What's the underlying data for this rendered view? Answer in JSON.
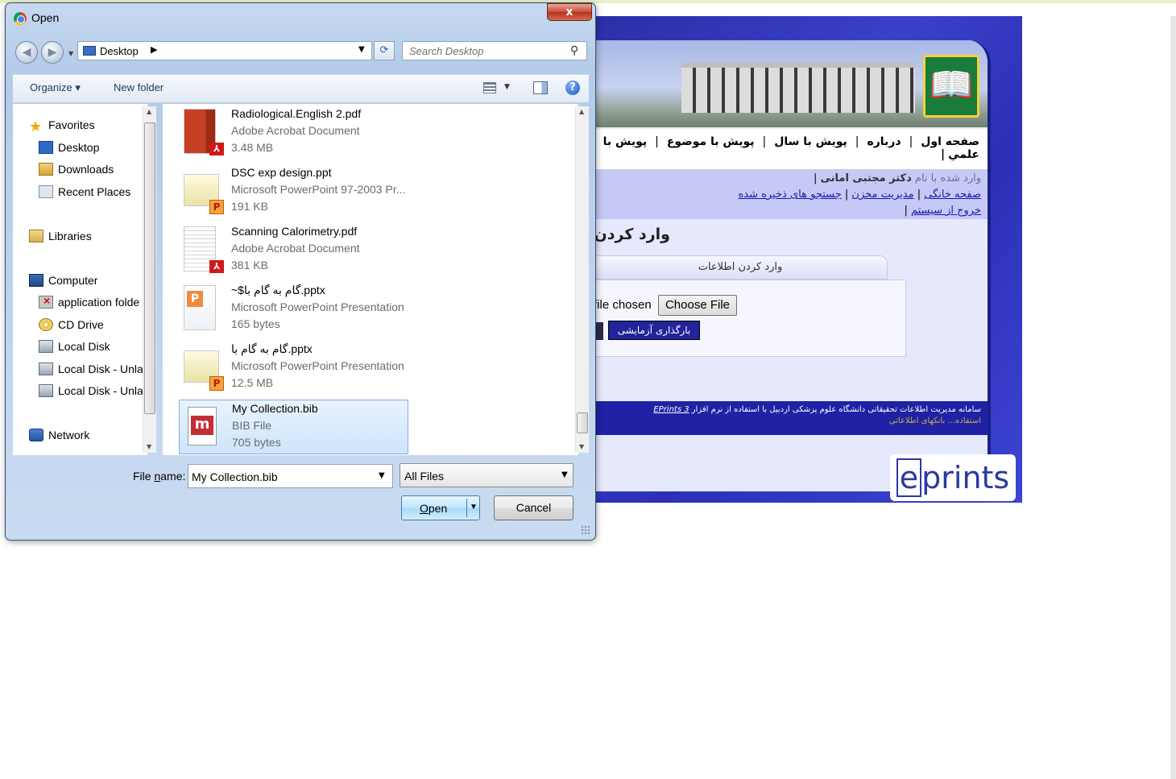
{
  "dialog": {
    "title": "Open",
    "close_glyph": "x",
    "address": {
      "location": "Desktop"
    },
    "search": {
      "placeholder": "Search Desktop"
    },
    "toolbar": {
      "organize": "Organize ▾",
      "new_folder": "New folder"
    },
    "nav": {
      "favorites": "Favorites",
      "desktop": "Desktop",
      "downloads": "Downloads",
      "recent_places": "Recent Places",
      "libraries": "Libraries",
      "computer": "Computer",
      "application_folder": "application folde",
      "cd_drive": "CD Drive",
      "local_disk": "Local Disk",
      "local_disk_unla_1": "Local Disk - Unla",
      "local_disk_unla_2": "Local Disk - Unla",
      "network": "Network"
    },
    "files": [
      {
        "name": "Radiological.English 2.pdf",
        "type": "Adobe Acrobat Document",
        "size": "3.48 MB"
      },
      {
        "name": "DSC exp design.ppt",
        "type": "Microsoft PowerPoint 97-2003 Pr...",
        "size": "191 KB"
      },
      {
        "name": "Scanning Calorimetry.pdf",
        "type": "Adobe Acrobat Document",
        "size": "381 KB"
      },
      {
        "name": "~$گام به گام با.pptx",
        "type": "Microsoft PowerPoint Presentation",
        "size": "165 bytes"
      },
      {
        "name": "گام به گام با.pptx",
        "type": "Microsoft PowerPoint Presentation",
        "size": "12.5 MB"
      },
      {
        "name": "My Collection.bib",
        "type": "BIB File",
        "size": "705 bytes"
      }
    ],
    "file_name_label_pre": "File ",
    "file_name_label_u": "n",
    "file_name_label_post": "ame:",
    "file_name_value": "My Collection.bib",
    "file_type_value": "All Files",
    "open_label_u": "O",
    "open_label_rest": "pen",
    "cancel_label": "Cancel"
  },
  "site": {
    "nav": {
      "home": "صفحه اول",
      "about": "درباره",
      "by_year": "پویش با سال",
      "by_subject": "پویش با موضوع",
      "by_partial": "پویش با",
      "scientific": "علمي"
    },
    "user_bar": {
      "logged_in_as": "وارد شده با نام",
      "user_name": "دکتر مجتبی امانی",
      "home_page": "صفحه خانگی",
      "manage_deposits": "مدیریت مخزن",
      "saved_searches": "جستجو های ذخیره شده",
      "logout": "خروج از سیستم"
    },
    "heading": "وارد کردن",
    "tab_label": "وارد کردن اطلاعات",
    "file_chosen": "file chosen",
    "choose_file": "Choose File",
    "upload_button": "بارگذاری آزمایشی",
    "footer_text": "سامانه مدیریت اطلاعات تحقیقاتی دانشگاه علوم پزشکی اردبیل با استفاده از نرم افزار",
    "footer_link": "EPrints 3",
    "footer_line2": "استفاده... بانکهای اطلاعاتی",
    "brand": "eprints"
  }
}
